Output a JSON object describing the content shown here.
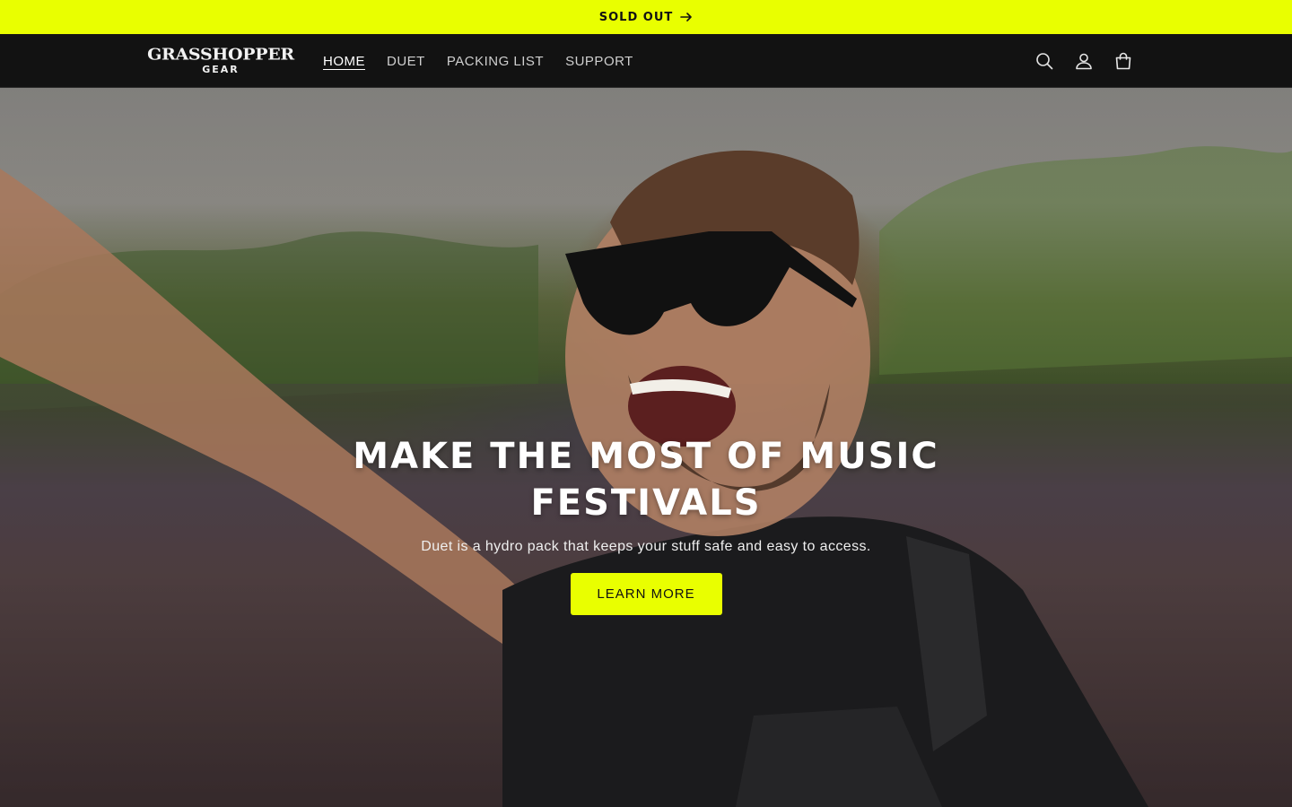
{
  "announcement": {
    "text": "SOLD OUT"
  },
  "brand": {
    "line1": "GRASSHOPPER",
    "line2": "GEAR",
    "accent": "#e9ff00",
    "background": "#121212"
  },
  "nav": {
    "items": [
      {
        "label": "HOME",
        "active": true
      },
      {
        "label": "DUET",
        "active": false
      },
      {
        "label": "PACKING LIST",
        "active": false
      },
      {
        "label": "SUPPORT",
        "active": false
      }
    ]
  },
  "header_icons": [
    "search-icon",
    "account-icon",
    "cart-icon"
  ],
  "hero": {
    "title_line1": "MAKE THE MOST OF MUSIC",
    "title_line2": "FESTIVALS",
    "subtitle": "Duet is a hydro pack that keeps your stuff safe and easy to access.",
    "cta_label": "LEARN MORE",
    "image_subject": "smiling man with sunglasses wearing a black hydro pack at an outdoor music festival crowd"
  }
}
